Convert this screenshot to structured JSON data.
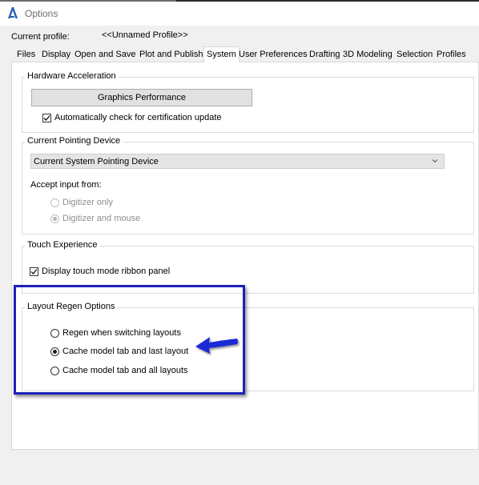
{
  "window": {
    "title": "Options"
  },
  "profile": {
    "label": "Current profile:",
    "value": "<<Unnamed Profile>>"
  },
  "tabs": [
    {
      "label": "Files"
    },
    {
      "label": "Display"
    },
    {
      "label": "Open and Save"
    },
    {
      "label": "Plot and Publish"
    },
    {
      "label": "System",
      "active": true
    },
    {
      "label": "User Preferences"
    },
    {
      "label": "Drafting"
    },
    {
      "label": "3D Modeling"
    },
    {
      "label": "Selection"
    },
    {
      "label": "Profiles"
    }
  ],
  "hardware": {
    "title": "Hardware Acceleration",
    "button": "Graphics Performance",
    "checkbox": {
      "label": "Automatically check for certification update",
      "checked": true
    }
  },
  "pointing": {
    "title": "Current Pointing Device",
    "selected": "Current System Pointing Device",
    "accept_label": "Accept input from:",
    "options": [
      {
        "label": "Digitizer only",
        "selected": false
      },
      {
        "label": "Digitizer and mouse",
        "selected": true
      }
    ]
  },
  "touch": {
    "title": "Touch Experience",
    "checkbox": {
      "label": "Display touch mode ribbon panel",
      "checked": true
    }
  },
  "layout": {
    "title": "Layout Regen Options",
    "options": [
      {
        "label": "Regen when switching layouts",
        "selected": false
      },
      {
        "label": "Cache model tab and last layout",
        "selected": true
      },
      {
        "label": "Cache model tab and all layouts",
        "selected": false
      }
    ]
  },
  "colors": {
    "highlight": "#1c22b8",
    "arrow": "#1c2bd6",
    "app_icon": "#1f5fb4"
  }
}
